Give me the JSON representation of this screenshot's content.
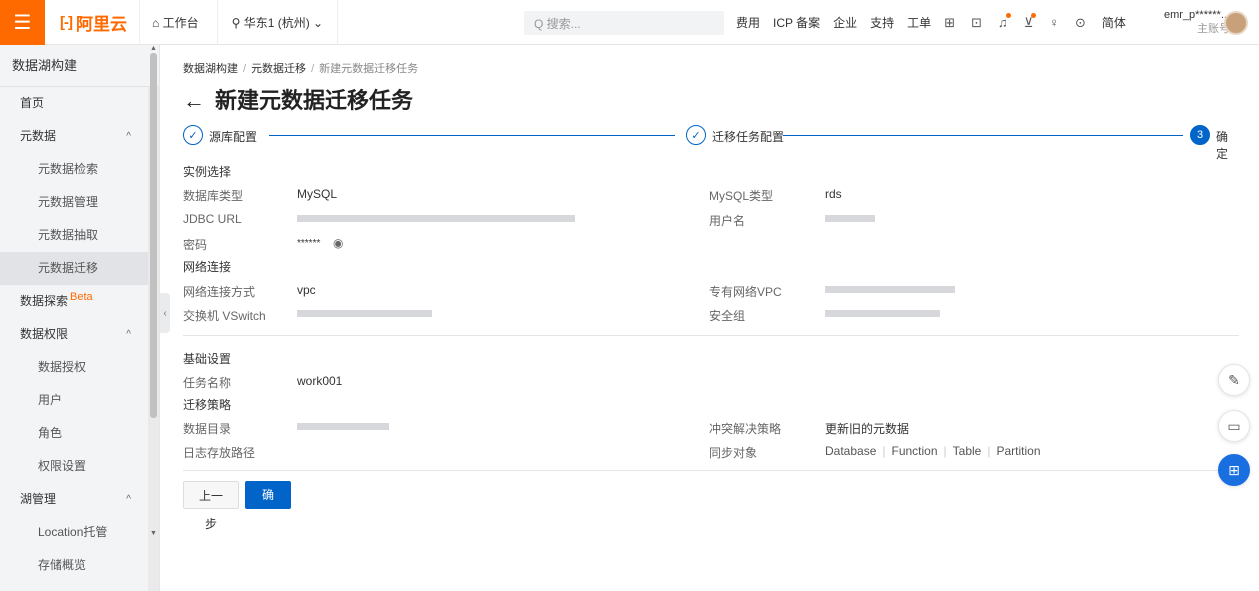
{
  "topbar": {
    "menu_icon": "hamburger-icon",
    "logo_mark": "[-]",
    "logo_text": "阿里云",
    "workbench": "⌂ 工作台",
    "region": "⚲ 华东1 (杭州)  ⌄",
    "search_placeholder": "Q 搜索...",
    "links": [
      "费用",
      "ICP 备案",
      "企业",
      "支持",
      "工单"
    ],
    "lang": "简体",
    "account_name": "emr_p******...",
    "account_sub": "主账号"
  },
  "sidebar": {
    "title": "数据湖构建",
    "items": [
      {
        "label": "首页"
      },
      {
        "label": "元数据",
        "arrow": "^"
      },
      {
        "label": "元数据检索"
      },
      {
        "label": "元数据管理"
      },
      {
        "label": "元数据抽取"
      },
      {
        "label": "元数据迁移"
      },
      {
        "label": "数据探索",
        "badge": "Beta"
      },
      {
        "label": "数据权限",
        "arrow": "^"
      },
      {
        "label": "数据授权"
      },
      {
        "label": "用户"
      },
      {
        "label": "角色"
      },
      {
        "label": "权限设置"
      },
      {
        "label": "湖管理",
        "arrow": "^"
      },
      {
        "label": "Location托管"
      },
      {
        "label": "存储概览"
      }
    ]
  },
  "breadcrumb": {
    "items": [
      "数据湖构建",
      "元数据迁移"
    ],
    "current": "新建元数据迁移任务"
  },
  "page": {
    "back": "←",
    "title": "新建元数据迁移任务"
  },
  "steps": [
    {
      "mark": "✓",
      "label": "源库配置"
    },
    {
      "mark": "✓",
      "label": "迁移任务配置"
    },
    {
      "mark": "3",
      "label": "确定"
    }
  ],
  "instance": {
    "section": "实例选择",
    "db_type_label": "数据库类型",
    "db_type_value": "MySQL",
    "mysql_type_label": "MySQL类型",
    "mysql_type_value": "rds",
    "jdbc_label": "JDBC URL",
    "user_label": "用户名",
    "password_label": "密码",
    "password_value": "******"
  },
  "network": {
    "section": "网络连接",
    "mode_label": "网络连接方式",
    "mode_value": "vpc",
    "vpc_label": "专有网络VPC",
    "vswitch_label": "交换机 VSwitch",
    "sg_label": "安全组"
  },
  "basic": {
    "section": "基础设置",
    "task_name_label": "任务名称",
    "task_name_value": "work001"
  },
  "strategy": {
    "section": "迁移策略",
    "data_dir_label": "数据目录",
    "conflict_label": "冲突解决策略",
    "conflict_value": "更新旧的元数据",
    "log_path_label": "日志存放路径",
    "sync_label": "同步对象",
    "sync_options": [
      "Database",
      "Function",
      "Table",
      "Partition"
    ]
  },
  "buttons": {
    "prev": "上一步",
    "ok": "确定"
  }
}
